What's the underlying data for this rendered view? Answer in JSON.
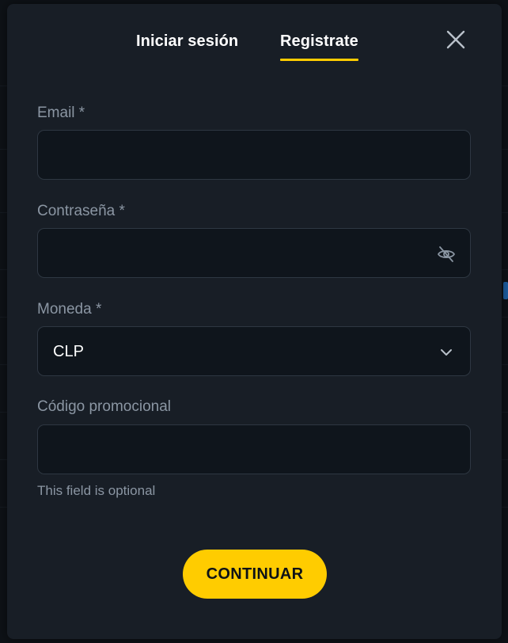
{
  "tabs": {
    "login": "Iniciar sesión",
    "register": "Registrate",
    "active": "register"
  },
  "form": {
    "email": {
      "label": "Email *",
      "value": ""
    },
    "password": {
      "label": "Contraseña *",
      "value": ""
    },
    "currency": {
      "label": "Moneda *",
      "value": "CLP"
    },
    "promo": {
      "label": "Código promocional",
      "value": "",
      "helper": "This field is optional"
    }
  },
  "continue_label": "CONTINUAR",
  "icons": {
    "close": "close-icon",
    "visibility": "eye-off-icon",
    "dropdown": "chevron-down-icon"
  },
  "colors": {
    "accent": "#ffcc00",
    "modal_bg": "#181e26",
    "input_bg": "#0f151c",
    "label": "#8b96a3"
  }
}
